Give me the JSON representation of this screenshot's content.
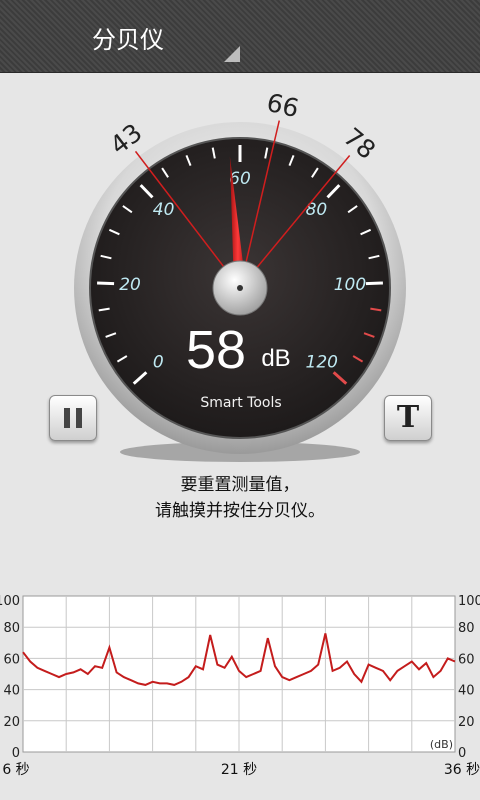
{
  "app": {
    "title": "分贝仪"
  },
  "meter": {
    "reading_value": "58",
    "reading_unit": "dB",
    "brand": "Smart Tools",
    "scale_labels": [
      "0",
      "20",
      "40",
      "60",
      "80",
      "100",
      "120"
    ],
    "markers": [
      {
        "label": "43",
        "value": 43
      },
      {
        "label": "66",
        "value": 66
      },
      {
        "label": "78",
        "value": 78
      }
    ],
    "needle_value": 58
  },
  "controls": {
    "pause_icon": "pause-icon",
    "text_button_label": "T"
  },
  "hint": {
    "line1": "要重置测量值，",
    "line2": "请触摸并按住分贝仪。"
  },
  "colors": {
    "accent_red": "#c21a1a",
    "dial_face": "#2a2525",
    "scale_text": "#bfe9f2"
  },
  "chart_data": {
    "type": "line",
    "ylim": [
      0,
      100
    ],
    "yticks": [
      "0",
      "20",
      "40",
      "60",
      "80",
      "100"
    ],
    "y_unit": "(dB)",
    "x_tick_labels": [
      "6 秒",
      "21 秒",
      "36 秒"
    ],
    "xlim": [
      6,
      36
    ],
    "x": [
      6,
      6.5,
      7,
      7.5,
      8,
      8.5,
      9,
      9.5,
      10,
      10.5,
      11,
      11.5,
      12,
      12.5,
      13,
      13.5,
      14,
      14.5,
      15,
      15.5,
      16,
      16.5,
      17,
      17.5,
      18,
      18.5,
      19,
      19.5,
      20,
      20.5,
      21,
      21.5,
      22,
      22.5,
      23,
      23.5,
      24,
      24.5,
      25,
      25.5,
      26,
      26.5,
      27,
      27.5,
      28,
      28.5,
      29,
      29.5,
      30,
      30.5,
      31,
      31.5,
      32,
      32.5,
      33,
      33.5,
      34,
      34.5,
      35,
      35.5,
      36
    ],
    "series": [
      {
        "values": [
          64,
          58,
          54,
          52,
          50,
          48,
          50,
          51,
          53,
          50,
          55,
          54,
          67,
          51,
          48,
          46,
          44,
          43,
          45,
          44,
          44,
          43,
          45,
          48,
          55,
          53,
          75,
          56,
          54,
          61,
          52,
          48,
          50,
          52,
          73,
          55,
          48,
          46,
          48,
          50,
          52,
          56,
          76,
          52,
          54,
          58,
          50,
          45,
          56,
          54,
          52,
          46,
          52,
          55,
          58,
          53,
          57,
          48,
          52,
          60,
          58
        ]
      }
    ]
  }
}
